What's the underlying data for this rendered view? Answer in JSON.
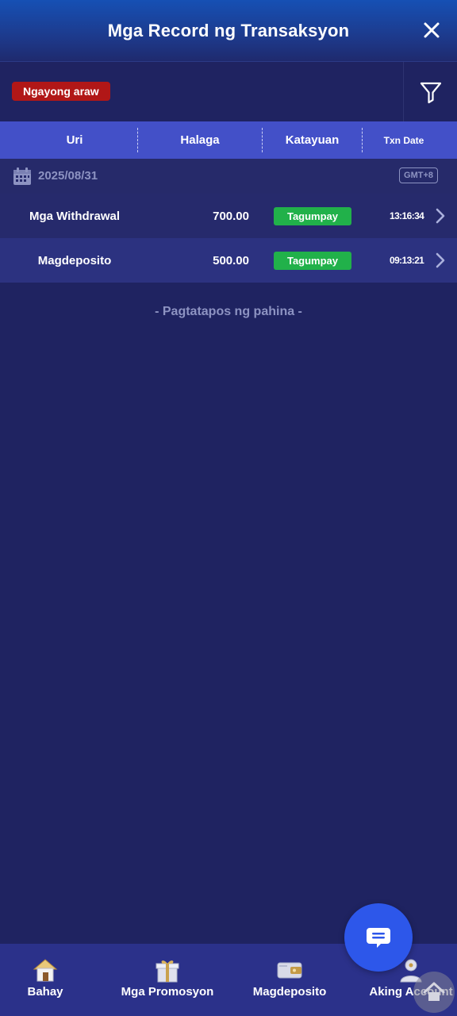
{
  "header": {
    "title": "Mga Record ng Transaksyon",
    "close_icon": "close-icon"
  },
  "filter": {
    "chip_label": "Ngayong araw",
    "filter_icon": "funnel-icon"
  },
  "columns": {
    "type": "Uri",
    "amount": "Halaga",
    "status": "Katayuan",
    "date": "Txn Date"
  },
  "date_group": {
    "date": "2025/08/31",
    "timezone": "GMT+8"
  },
  "transactions": [
    {
      "type": "Mga Withdrawal",
      "amount": "700.00",
      "status": "Tagumpay",
      "time": "13:16:34"
    },
    {
      "type": "Magdeposito",
      "amount": "500.00",
      "status": "Tagumpay",
      "time": "09:13:21"
    }
  ],
  "end_text": "- Pagtatapos ng pahina -",
  "nav": [
    {
      "label": "Bahay",
      "icon": "home-icon"
    },
    {
      "label": "Mga Promosyon",
      "icon": "gift-icon"
    },
    {
      "label": "Magdeposito",
      "icon": "wallet-icon"
    },
    {
      "label": "Aking Account",
      "icon": "account-icon"
    }
  ],
  "colors": {
    "background": "#1f2361",
    "column_header": "#4350c8",
    "success": "#21b14a",
    "chip": "#b11717",
    "fab": "#2d57ea"
  }
}
